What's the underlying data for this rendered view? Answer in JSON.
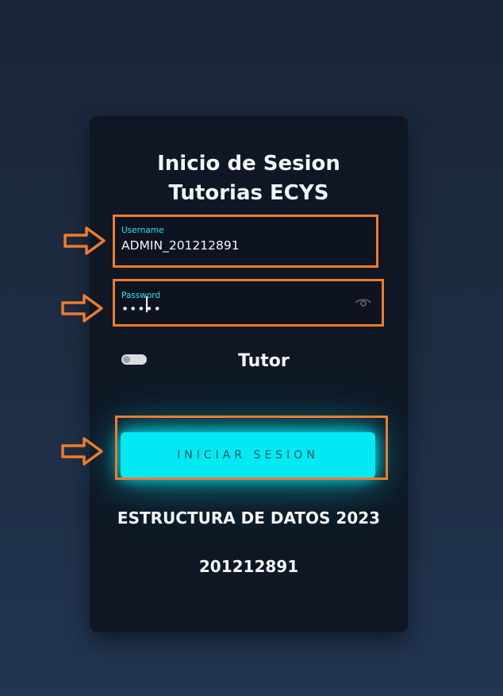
{
  "login": {
    "title_line1": "Inicio de Sesion",
    "title_line2": "Tutorias ECYS",
    "username_label": "Username",
    "username_value": "ADMIN_201212891",
    "password_label": "Password",
    "password_value": "•••••",
    "toggle_label": "Tutor",
    "submit_label": "INICIAR SESION",
    "course_text": "ESTRUCTURA DE DATOS 2023",
    "student_id": "201212891"
  },
  "icons": {
    "password_toggle": "eye-icon",
    "annotation": "arrow-right-icon"
  },
  "colors": {
    "accent": "#03e9f4",
    "card": "#0f1724",
    "annotation": "#f07b2b"
  }
}
